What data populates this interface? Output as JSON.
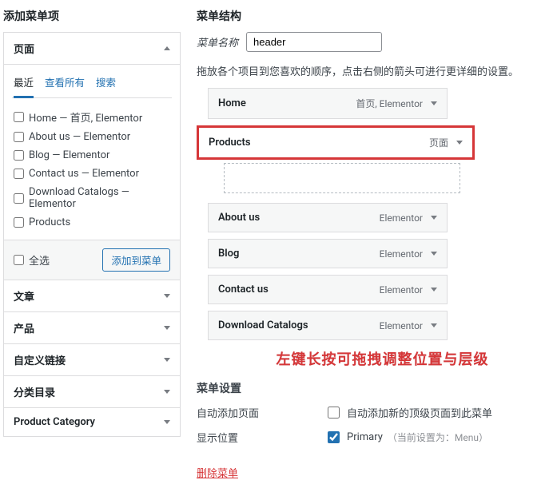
{
  "left": {
    "title": "添加菜单项",
    "sections": [
      {
        "label": "页面",
        "open": true
      },
      {
        "label": "文章",
        "open": false
      },
      {
        "label": "产品",
        "open": false
      },
      {
        "label": "自定义链接",
        "open": false
      },
      {
        "label": "分类目录",
        "open": false
      },
      {
        "label": "Product Category",
        "open": false
      }
    ],
    "tabs": [
      "最近",
      "查看所有",
      "搜索"
    ],
    "active_tab": 0,
    "pages": [
      "Home — 首页, Elementor",
      "About us — Elementor",
      "Blog — Elementor",
      "Contact us — Elementor",
      "Download Catalogs — Elementor",
      "Products"
    ],
    "select_all": "全选",
    "add_btn": "添加到菜单"
  },
  "right": {
    "title": "菜单结构",
    "name_label": "菜单名称",
    "name_value": "header",
    "hint": "拖放各个项目到您喜欢的顺序，点击右侧的箭头可进行更详细的设置。",
    "items": [
      {
        "title": "Home",
        "type": "首页, Elementor",
        "drag": false
      },
      {
        "title": "Products",
        "type": "页面",
        "drag": true
      },
      {
        "title": "About us",
        "type": "Elementor",
        "drag": false
      },
      {
        "title": "Blog",
        "type": "Elementor",
        "drag": false
      },
      {
        "title": "Contact us",
        "type": "Elementor",
        "drag": false
      },
      {
        "title": "Download Catalogs",
        "type": "Elementor",
        "drag": false
      }
    ],
    "annotation": "左键长按可拖拽调整位置与层级",
    "settings_title": "菜单设置",
    "auto_add_label": "自动添加页面",
    "auto_add_text": "自动添加新的顶级页面到此菜单",
    "loc_label": "显示位置",
    "loc_text": "Primary",
    "loc_note": "（当前设置为：Menu）",
    "delete": "删除菜单"
  }
}
